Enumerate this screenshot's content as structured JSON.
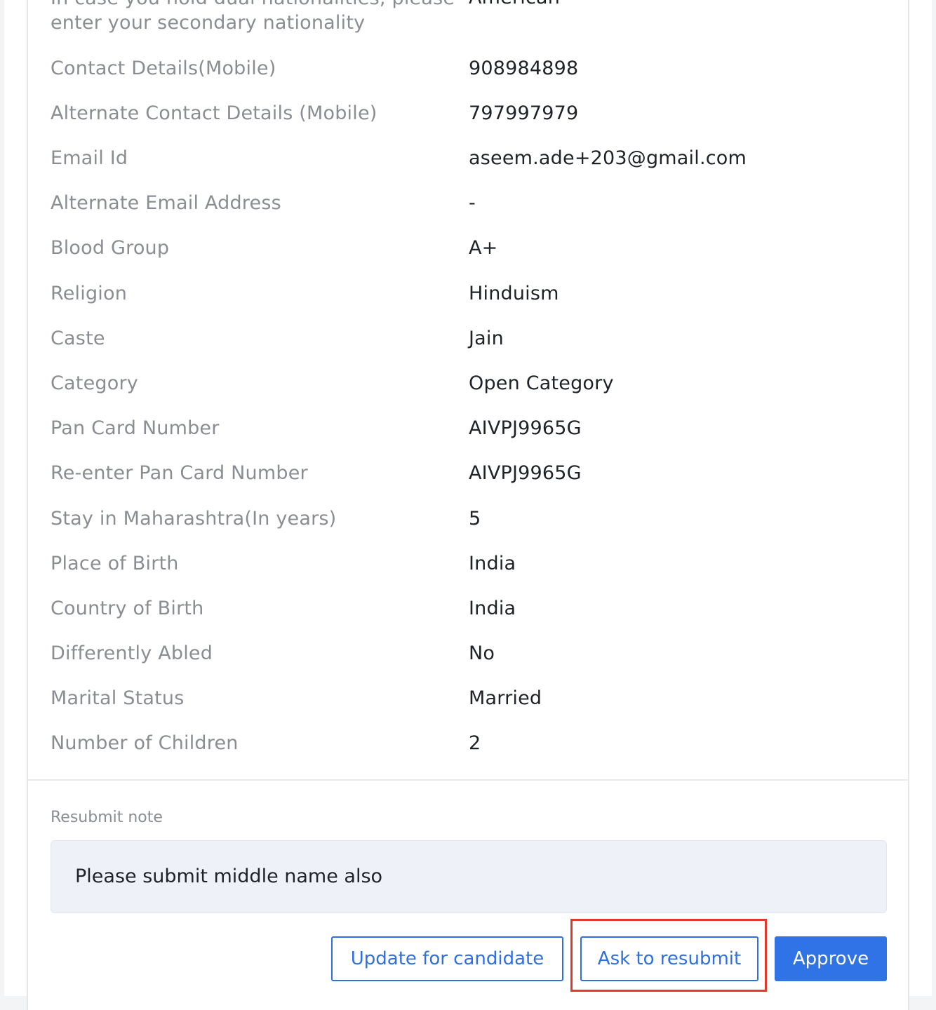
{
  "details": [
    {
      "label": "In case you hold dual nationalities, please enter your secondary nationality",
      "value": "American"
    },
    {
      "label": "Contact Details(Mobile)",
      "value": "908984898"
    },
    {
      "label": "Alternate Contact Details (Mobile)",
      "value": "797997979"
    },
    {
      "label": "Email Id",
      "value": "aseem.ade+203@gmail.com"
    },
    {
      "label": "Alternate Email Address",
      "value": "-"
    },
    {
      "label": "Blood Group",
      "value": "A+"
    },
    {
      "label": "Religion",
      "value": "Hinduism"
    },
    {
      "label": "Caste",
      "value": "Jain"
    },
    {
      "label": "Category",
      "value": "Open Category"
    },
    {
      "label": "Pan Card Number",
      "value": "AIVPJ9965G"
    },
    {
      "label": "Re-enter Pan Card Number",
      "value": "AIVPJ9965G"
    },
    {
      "label": "Stay in Maharashtra(In years)",
      "value": "5"
    },
    {
      "label": "Place of Birth",
      "value": "India"
    },
    {
      "label": "Country of Birth",
      "value": "India"
    },
    {
      "label": "Differently Abled",
      "value": "No"
    },
    {
      "label": "Marital Status",
      "value": "Married"
    },
    {
      "label": "Number of Children",
      "value": "2"
    }
  ],
  "resubmit": {
    "label": "Resubmit note",
    "note": "Please submit middle name also"
  },
  "actions": {
    "update_label": "Update for candidate",
    "resubmit_label": "Ask to resubmit",
    "approve_label": "Approve"
  },
  "colors": {
    "primary": "#2f73e6",
    "highlight": "#e23a2a",
    "label_text": "#8a8d93",
    "value_text": "#1f2329",
    "note_bg": "#eef1f8"
  }
}
